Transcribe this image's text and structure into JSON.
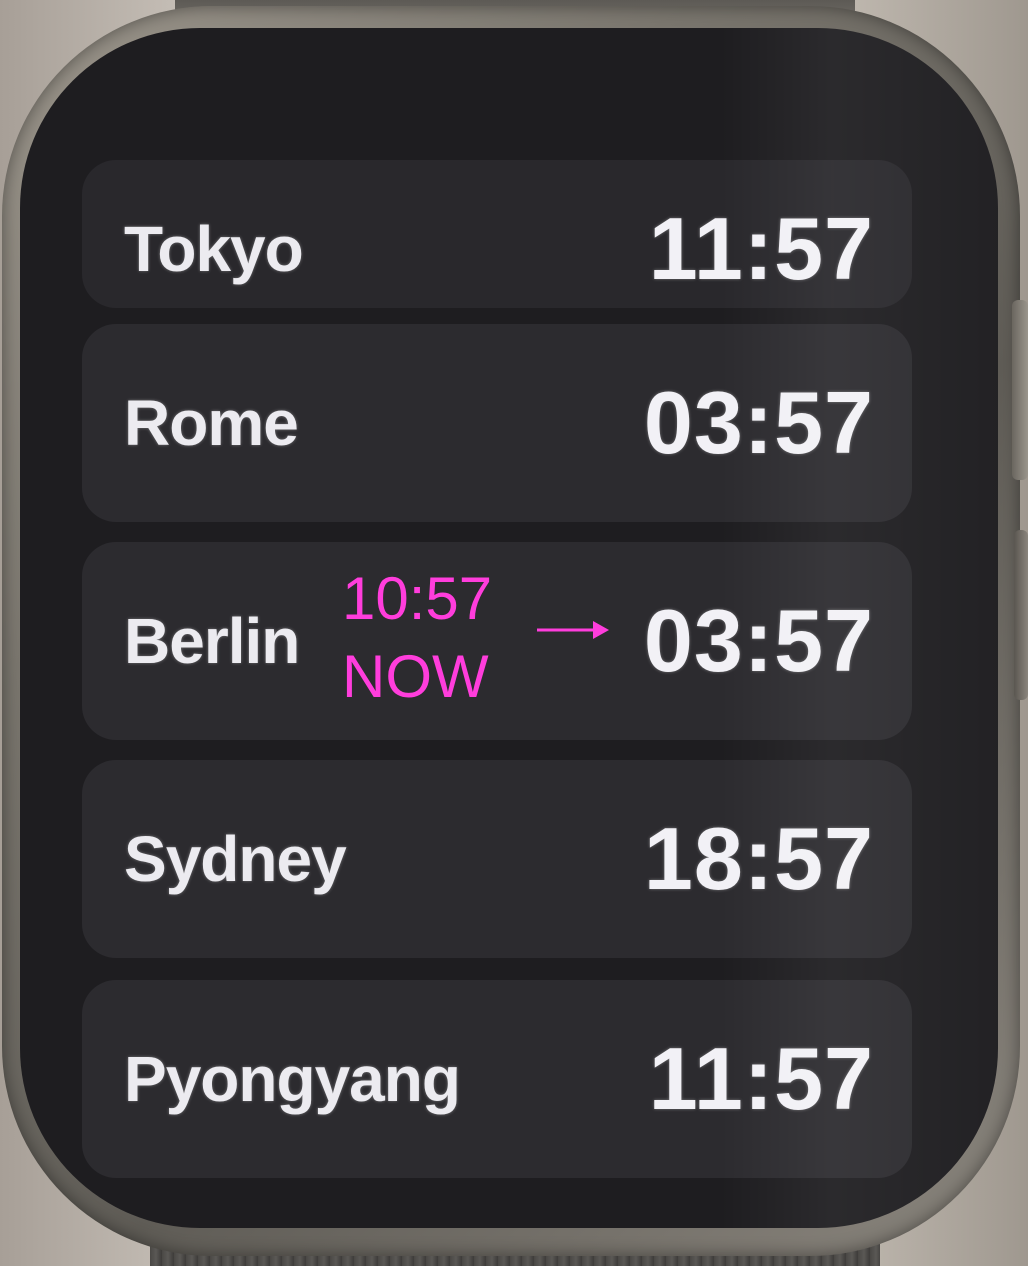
{
  "world_clock": {
    "rows": [
      {
        "city": "Tokyo",
        "time": "11:57"
      },
      {
        "city": "Rome",
        "time": "03:57"
      },
      {
        "city": "Berlin",
        "time": "03:57"
      },
      {
        "city": "Sydney",
        "time": "18:57"
      },
      {
        "city": "Pyongyang",
        "time": "11:57"
      }
    ]
  },
  "annotation": {
    "time": "10:57",
    "label": "NOW",
    "color": "#ff3ddc"
  },
  "icons": {
    "arrow": "arrow-right-icon"
  }
}
